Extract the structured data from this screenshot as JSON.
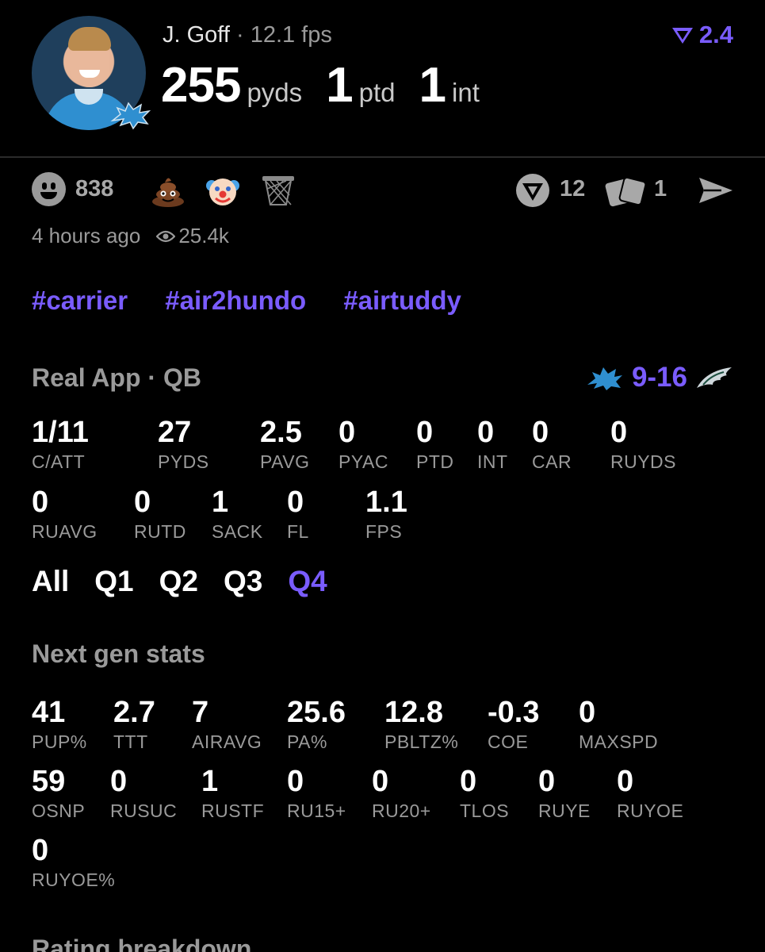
{
  "header": {
    "player_name": "J. Goff",
    "separator": "·",
    "fps_text": "12.1 fps",
    "rating": "2.4",
    "accent_color": "#7a5cff",
    "big_stats": [
      {
        "value": "255",
        "unit": "pyds"
      },
      {
        "value": "1",
        "unit": "ptd"
      },
      {
        "value": "1",
        "unit": "int"
      }
    ]
  },
  "reactions": {
    "smile_count": "838",
    "emoji_icons": [
      "poop-icon",
      "clown-icon",
      "basketball-hoop-icon"
    ],
    "actions": [
      {
        "icon": "fantasy-logo-icon",
        "count": "12"
      },
      {
        "icon": "cards-icon",
        "count": "1"
      },
      {
        "icon": "send-icon",
        "count": ""
      }
    ]
  },
  "meta": {
    "time": "4 hours ago",
    "views": "25.4k"
  },
  "tags": [
    "#carrier",
    "#air2hundo",
    "#airtuddy"
  ],
  "real_app": {
    "title": "Real App · QB",
    "score": "9-16",
    "stats_row1": [
      {
        "value": "1/11",
        "label": "C/ATT"
      },
      {
        "value": "27",
        "label": "PYDS"
      },
      {
        "value": "2.5",
        "label": "PAVG"
      },
      {
        "value": "0",
        "label": "PYAC"
      },
      {
        "value": "0",
        "label": "PTD"
      },
      {
        "value": "0",
        "label": "INT"
      },
      {
        "value": "0",
        "label": "CAR"
      },
      {
        "value": "0",
        "label": "RUYDS"
      }
    ],
    "stats_row2": [
      {
        "value": "0",
        "label": "RUAVG"
      },
      {
        "value": "0",
        "label": "RUTD"
      },
      {
        "value": "1",
        "label": "SACK"
      },
      {
        "value": "0",
        "label": "FL"
      },
      {
        "value": "1.1",
        "label": "FPS"
      }
    ]
  },
  "quarters": {
    "items": [
      "All",
      "Q1",
      "Q2",
      "Q3",
      "Q4"
    ],
    "active": "Q4"
  },
  "next_gen": {
    "title": "Next gen stats",
    "row1": [
      {
        "value": "41",
        "label": "PUP%"
      },
      {
        "value": "2.7",
        "label": "TTT"
      },
      {
        "value": "7",
        "label": "AIRAVG"
      },
      {
        "value": "25.6",
        "label": "PA%"
      },
      {
        "value": "12.8",
        "label": "PBLTZ%"
      },
      {
        "value": "-0.3",
        "label": "COE"
      },
      {
        "value": "0",
        "label": "MAXSPD"
      }
    ],
    "row2": [
      {
        "value": "59",
        "label": "OSNP"
      },
      {
        "value": "0",
        "label": "RUSUC"
      },
      {
        "value": "1",
        "label": "RUSTF"
      },
      {
        "value": "0",
        "label": "RU15+"
      },
      {
        "value": "0",
        "label": "RU20+"
      },
      {
        "value": "0",
        "label": "TLOS"
      },
      {
        "value": "0",
        "label": "RUYE"
      },
      {
        "value": "0",
        "label": "RUYOE"
      }
    ],
    "row3": [
      {
        "value": "0",
        "label": "RUYOE%"
      }
    ]
  },
  "footer": {
    "title": "Rating breakdown"
  }
}
